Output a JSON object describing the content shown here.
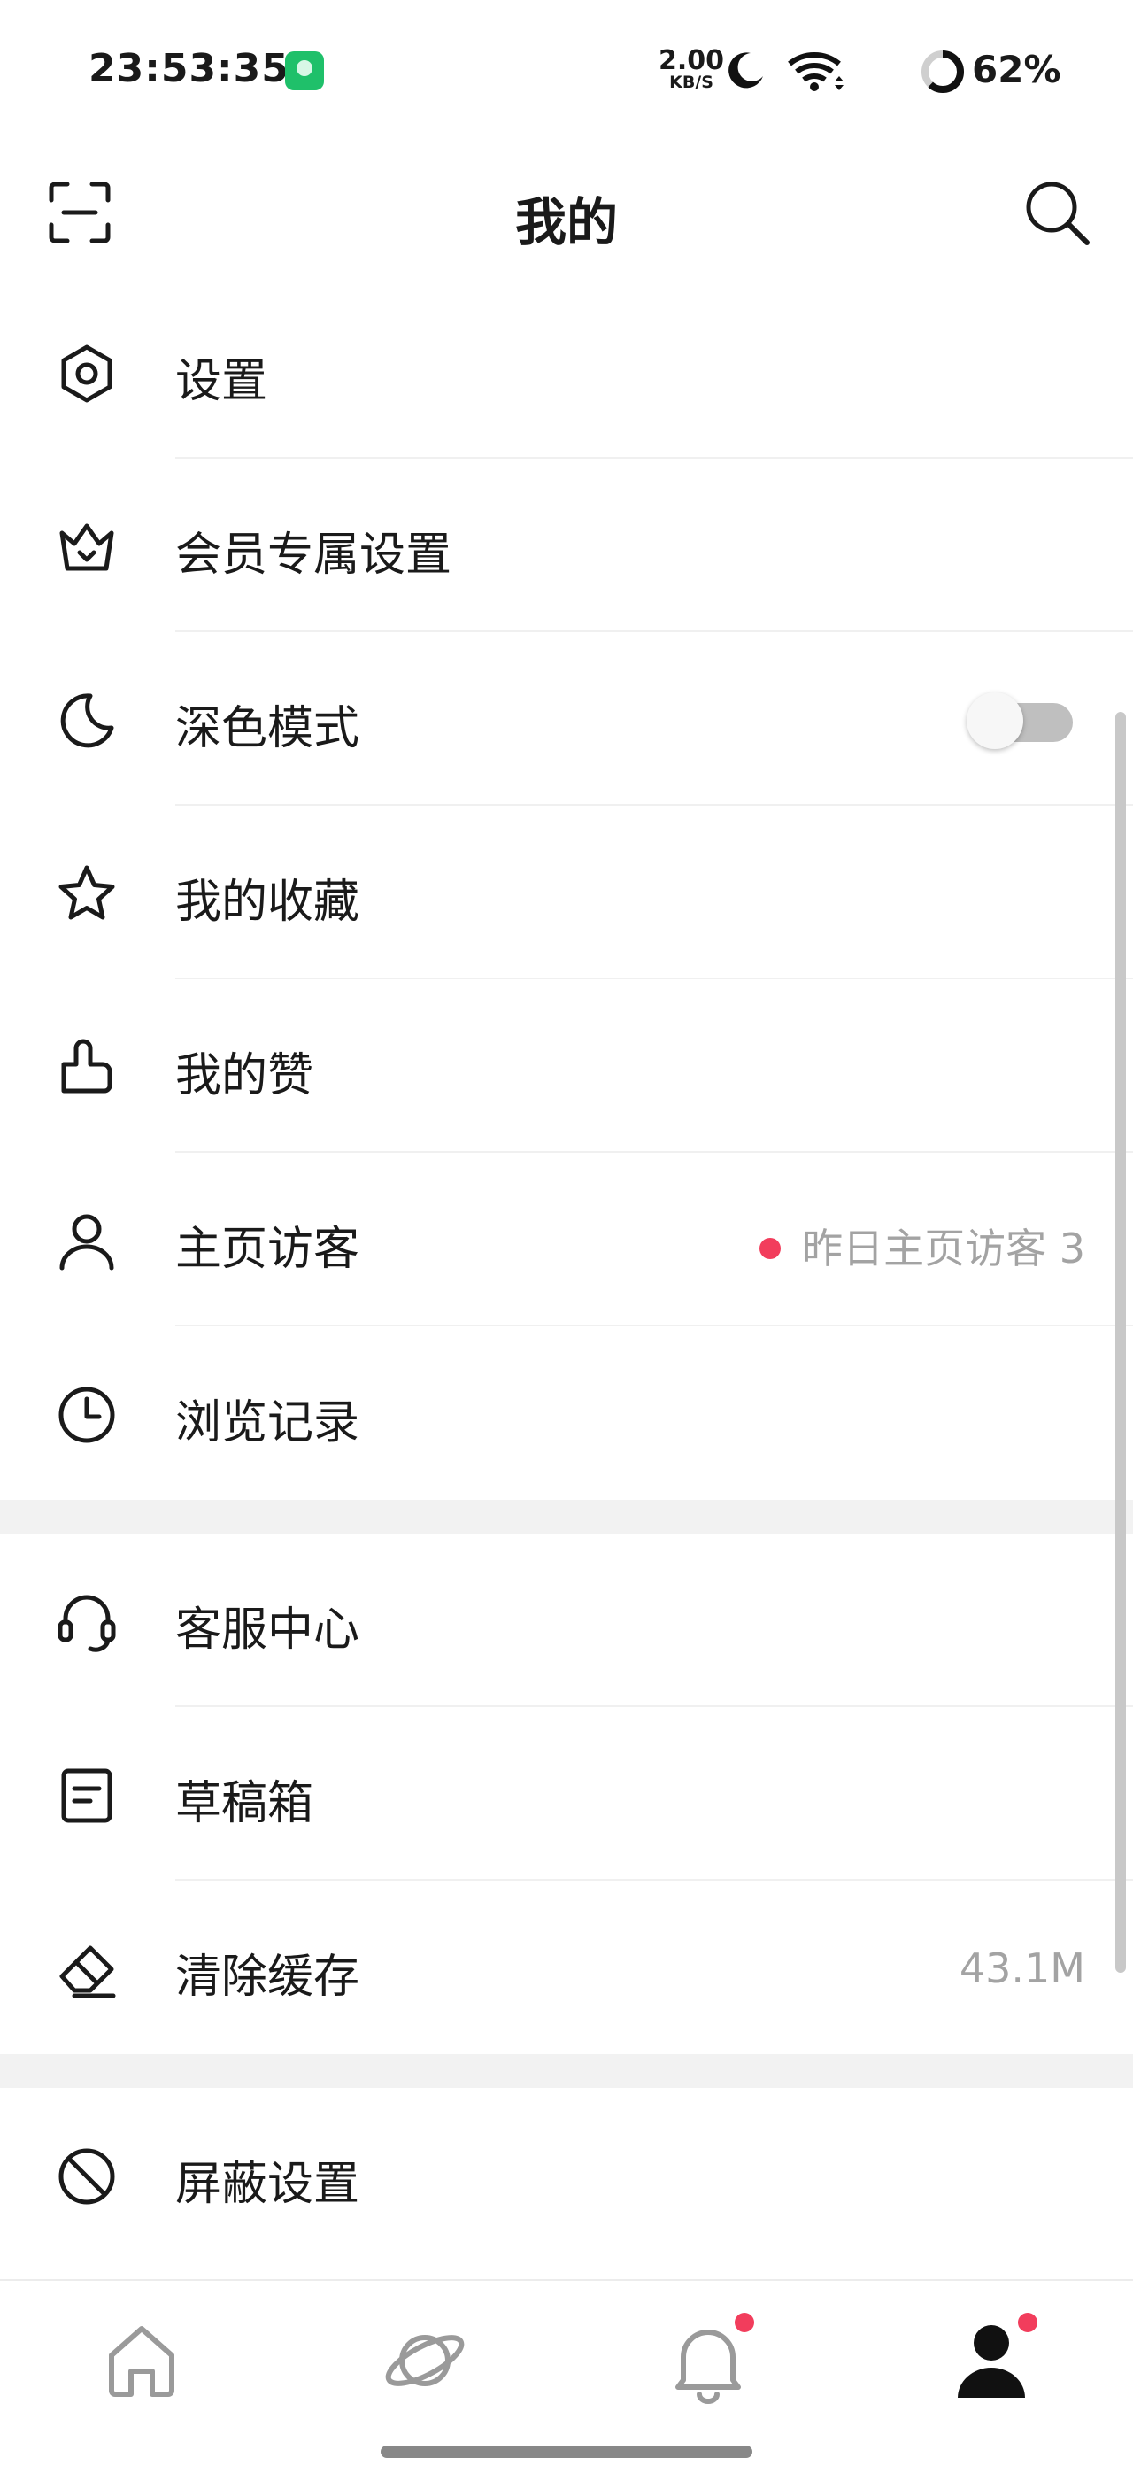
{
  "status_bar": {
    "time": "23:53:35",
    "net_speed_value": "2.00",
    "net_speed_unit": "KB/S",
    "battery": "62%",
    "battery_level": 0.62
  },
  "header": {
    "title": "我的"
  },
  "menu": {
    "settings": {
      "label": "设置",
      "icon": "hexagon-gear-icon"
    },
    "vip_settings": {
      "label": "会员专属设置",
      "icon": "crown-icon"
    },
    "dark_mode": {
      "label": "深色模式",
      "icon": "moon-icon",
      "enabled": false
    },
    "favorites": {
      "label": "我的收藏",
      "icon": "star-icon"
    },
    "likes": {
      "label": "我的赞",
      "icon": "thumbs-up-icon"
    },
    "visitors": {
      "label": "主页访客",
      "icon": "person-icon",
      "hint": "昨日主页访客 3"
    },
    "history": {
      "label": "浏览记录",
      "icon": "clock-icon"
    },
    "support": {
      "label": "客服中心",
      "icon": "headset-icon"
    },
    "drafts": {
      "label": "草稿箱",
      "icon": "document-icon"
    },
    "clear_cache": {
      "label": "清除缓存",
      "icon": "eraser-icon",
      "value": "43.1M"
    },
    "block_settings": {
      "label": "屏蔽设置",
      "icon": "block-icon"
    }
  },
  "bottom_nav": [
    {
      "id": "home",
      "icon": "home-icon",
      "active": false,
      "badge": false
    },
    {
      "id": "discover",
      "icon": "planet-icon",
      "active": false,
      "badge": false
    },
    {
      "id": "notifications",
      "icon": "bell-icon",
      "active": false,
      "badge": true
    },
    {
      "id": "me",
      "icon": "person-filled-icon",
      "active": true,
      "badge": true
    }
  ],
  "colors": {
    "accent_red": "#f23d5c",
    "text_primary": "#1a1a1a",
    "text_secondary": "#a3a3a3",
    "section_gap": "#f2f2f2"
  }
}
